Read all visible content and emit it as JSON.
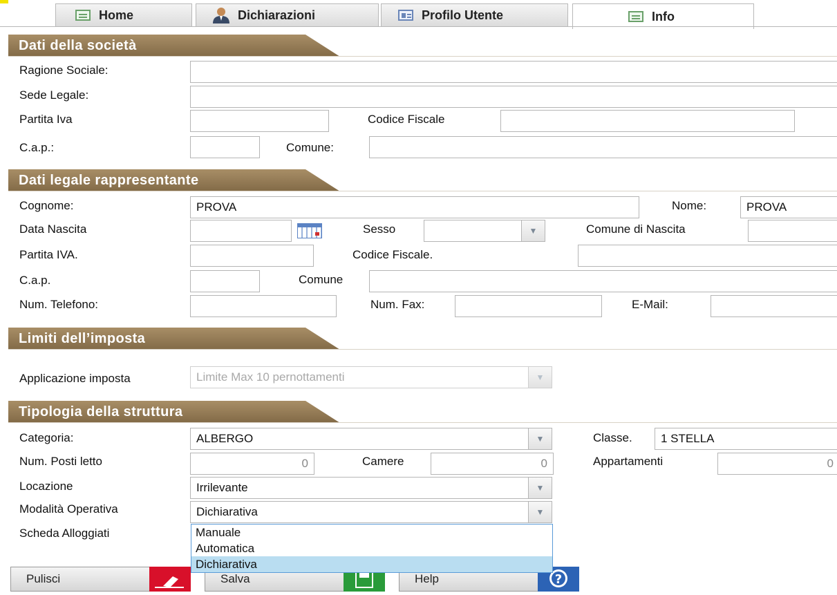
{
  "tabs": [
    {
      "label": "Home",
      "icon": "document-icon",
      "active": false
    },
    {
      "label": "Dichiarazioni",
      "icon": "user-icon",
      "active": false
    },
    {
      "label": "Profilo Utente",
      "icon": "id-card-icon",
      "active": false
    },
    {
      "label": "Info",
      "icon": "document-icon",
      "active": true
    }
  ],
  "sections": {
    "societa": {
      "title": "Dati della società",
      "ragione_sociale_label": "Ragione Sociale:",
      "sede_legale_label": "Sede Legale:",
      "partita_iva_label": "Partita Iva",
      "codice_fiscale_label": "Codice Fiscale",
      "cap_label": "C.a.p.:",
      "comune_label": "Comune:"
    },
    "legale": {
      "title": "Dati legale rappresentante",
      "cognome_label": "Cognome:",
      "cognome_value": "PROVA",
      "nome_label": "Nome:",
      "nome_value": "PROVA",
      "data_nascita_label": "Data Nascita",
      "sesso_label": "Sesso",
      "comune_nascita_label": "Comune di Nascita",
      "partita_iva_label": "Partita IVA.",
      "codice_fiscale_label": "Codice Fiscale.",
      "cap_label": "C.a.p.",
      "comune_label": "Comune",
      "telefono_label": "Num. Telefono:",
      "fax_label": "Num. Fax:",
      "email_label": "E-Mail:"
    },
    "limiti": {
      "title": "Limiti dell’imposta",
      "applicazione_label": "Applicazione imposta",
      "applicazione_value": "Limite Max 10 pernottamenti"
    },
    "tipologia": {
      "title": "Tipologia della struttura",
      "categoria_label": "Categoria:",
      "categoria_value": "ALBERGO",
      "classe_label": "Classe.",
      "classe_value": "1 STELLA",
      "posti_letto_label": "Num. Posti letto",
      "posti_letto_value": "0",
      "camere_label": "Camere",
      "camere_value": "0",
      "appartamenti_label": "Appartamenti",
      "appartamenti_value": "0",
      "locazione_label": "Locazione",
      "locazione_value": "Irrilevante",
      "modalita_label": "Modalità Operativa",
      "modalita_value": "Dichiarativa",
      "scheda_label": "Scheda Alloggiati",
      "modalita_options": [
        "Manuale",
        "Automatica",
        "Dichiarativa"
      ],
      "modalita_selected": "Dichiarativa"
    }
  },
  "buttons": {
    "pulisci": "Pulisci",
    "salva": "Salva",
    "help": "Help",
    "help_glyph": "?"
  }
}
